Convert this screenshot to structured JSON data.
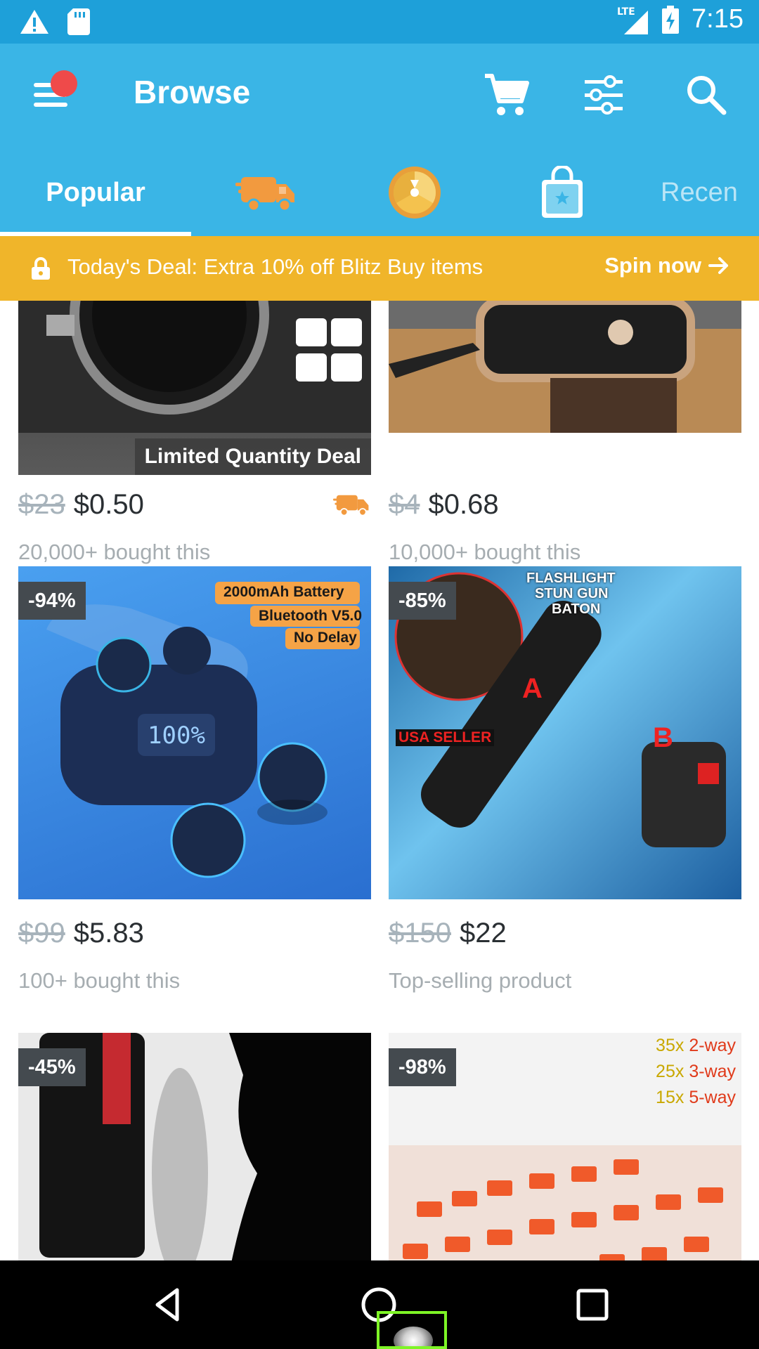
{
  "status_bar": {
    "network": "LTE",
    "time": "7:15"
  },
  "app_bar": {
    "title": "Browse",
    "icons": [
      "menu-icon",
      "cart-icon",
      "filter-icon",
      "search-icon"
    ]
  },
  "tabs": {
    "popular": "Popular",
    "shipping_icon": "shipping-truck-icon",
    "wheel_icon": "spin-wheel-icon",
    "bag_icon": "shopping-bag-icon",
    "recent": "Recen"
  },
  "deal_banner": {
    "text": "Today's Deal: Extra 10% off Blitz Buy items",
    "action": "Spin now"
  },
  "products": [
    {
      "badge": "",
      "overlay": "Limited Quantity Deal",
      "old_price": "$23",
      "price": "$0.50",
      "sub": "20,000+ bought this",
      "fast_shipping": true
    },
    {
      "badge": "",
      "old_price": "$4",
      "price": "$0.68",
      "sub": "10,000+ bought this"
    },
    {
      "badge": "-94%",
      "image_text": [
        "2000mAh Battery",
        "Bluetooth V5.0",
        "No Delay"
      ],
      "old_price": "$99",
      "price": "$5.83",
      "sub": "100+ bought this"
    },
    {
      "badge": "-85%",
      "image_text": [
        "FLASHLIGHT",
        "STUN GUN",
        "BATON",
        "USA SELLER",
        "A",
        "B"
      ],
      "old_price": "$150",
      "price": "$22",
      "sub": "Top-selling product"
    },
    {
      "badge": "-45%",
      "old_price": "",
      "price": "",
      "sub": ""
    },
    {
      "badge": "-98%",
      "image_text": [
        "35x",
        "2-way",
        "25x",
        "3-way",
        "15x",
        "5-way"
      ],
      "old_price": "",
      "price": "",
      "sub": ""
    }
  ],
  "colors": {
    "status_bar": "#1ea0d9",
    "app_bar": "#3ab5e6",
    "deal_banner": "#f0b52a",
    "badge": "#444a4f",
    "notification": "#ef4a4a",
    "shipping_orange": "#f29a3f"
  }
}
